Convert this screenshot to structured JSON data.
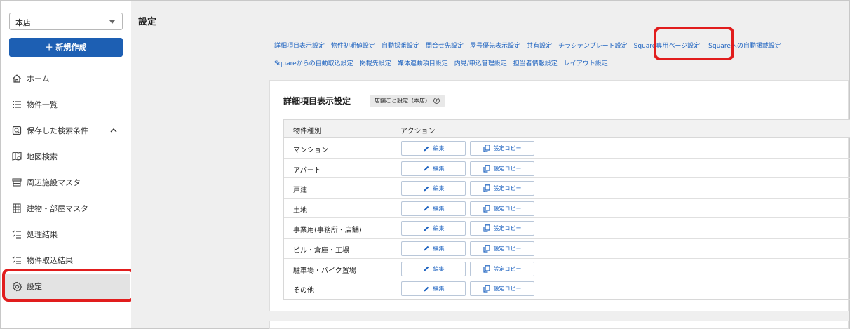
{
  "sidebar": {
    "store_select": "本店",
    "new_button": "＋ 新規作成",
    "items": [
      {
        "label": "ホーム"
      },
      {
        "label": "物件一覧"
      },
      {
        "label": "保存した検索条件"
      },
      {
        "label": "地図検索"
      },
      {
        "label": "周辺施設マスタ"
      },
      {
        "label": "建物・部屋マスタ"
      },
      {
        "label": "処理結果"
      },
      {
        "label": "物件取込結果"
      },
      {
        "label": "設定"
      }
    ]
  },
  "main": {
    "title": "設定",
    "links_row1": [
      "詳細項目表示設定",
      "物件初期値設定",
      "自動採番設定",
      "問合せ先設定",
      "屋号優先表示設定",
      "共有設定",
      "チラシテンプレート設定",
      "Square専用ページ設定",
      "Squareへの自動掲載設定"
    ],
    "links_row2": [
      "Squareからの自動取込設定",
      "掲載先設定",
      "媒体連動項目設定",
      "内見/申込管理設定",
      "担当者情報設定",
      "レイアウト設定"
    ],
    "card": {
      "title": "詳細項目表示設定",
      "badge": "店舗ごと設定（本店）",
      "badge_help": "?",
      "columns": [
        "物件種別",
        "アクション"
      ],
      "edit_label": "編集",
      "copy_label": "設定コピー",
      "rows": [
        {
          "name": "マンション"
        },
        {
          "name": "アパート"
        },
        {
          "name": "戸建"
        },
        {
          "name": "土地"
        },
        {
          "name": "事業用(事務所・店舗)"
        },
        {
          "name": "ビル・倉庫・工場"
        },
        {
          "name": "駐車場・バイク置場"
        },
        {
          "name": "その他"
        }
      ]
    }
  },
  "colors": {
    "primary": "#1d5fb3",
    "link": "#1e63c0",
    "highlight": "#e11d1d"
  }
}
